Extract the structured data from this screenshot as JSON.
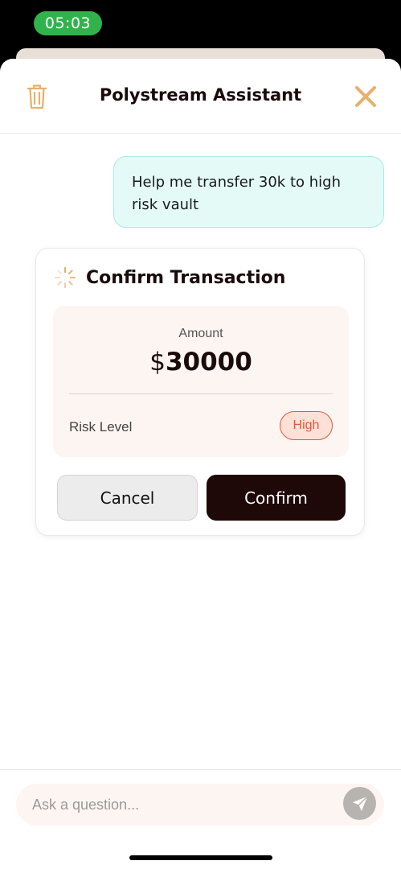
{
  "status_bar": {
    "time": "05:03"
  },
  "header": {
    "title": "Polystream Assistant",
    "trash_icon": "trash-icon",
    "close_icon": "close-icon"
  },
  "chat": {
    "user_message": "Help me transfer 30k to high risk vault"
  },
  "transaction_card": {
    "title": "Confirm Transaction",
    "status_icon": "loading-spinner-icon",
    "amount_label": "Amount",
    "currency_symbol": "$",
    "amount_value": "30000",
    "risk_label": "Risk Level",
    "risk_value": "High",
    "cancel_label": "Cancel",
    "confirm_label": "Confirm"
  },
  "composer": {
    "placeholder": "Ask a question...",
    "send_icon": "send-icon"
  },
  "colors": {
    "accent": "#e8b06c",
    "status_green": "#30b34b",
    "user_bubble_bg": "#e3faf7",
    "user_bubble_border": "#a8ebe3",
    "panel_bg": "#fdf5f1",
    "risk_high": "#e05a3c",
    "confirm_bg": "#1e0808"
  }
}
